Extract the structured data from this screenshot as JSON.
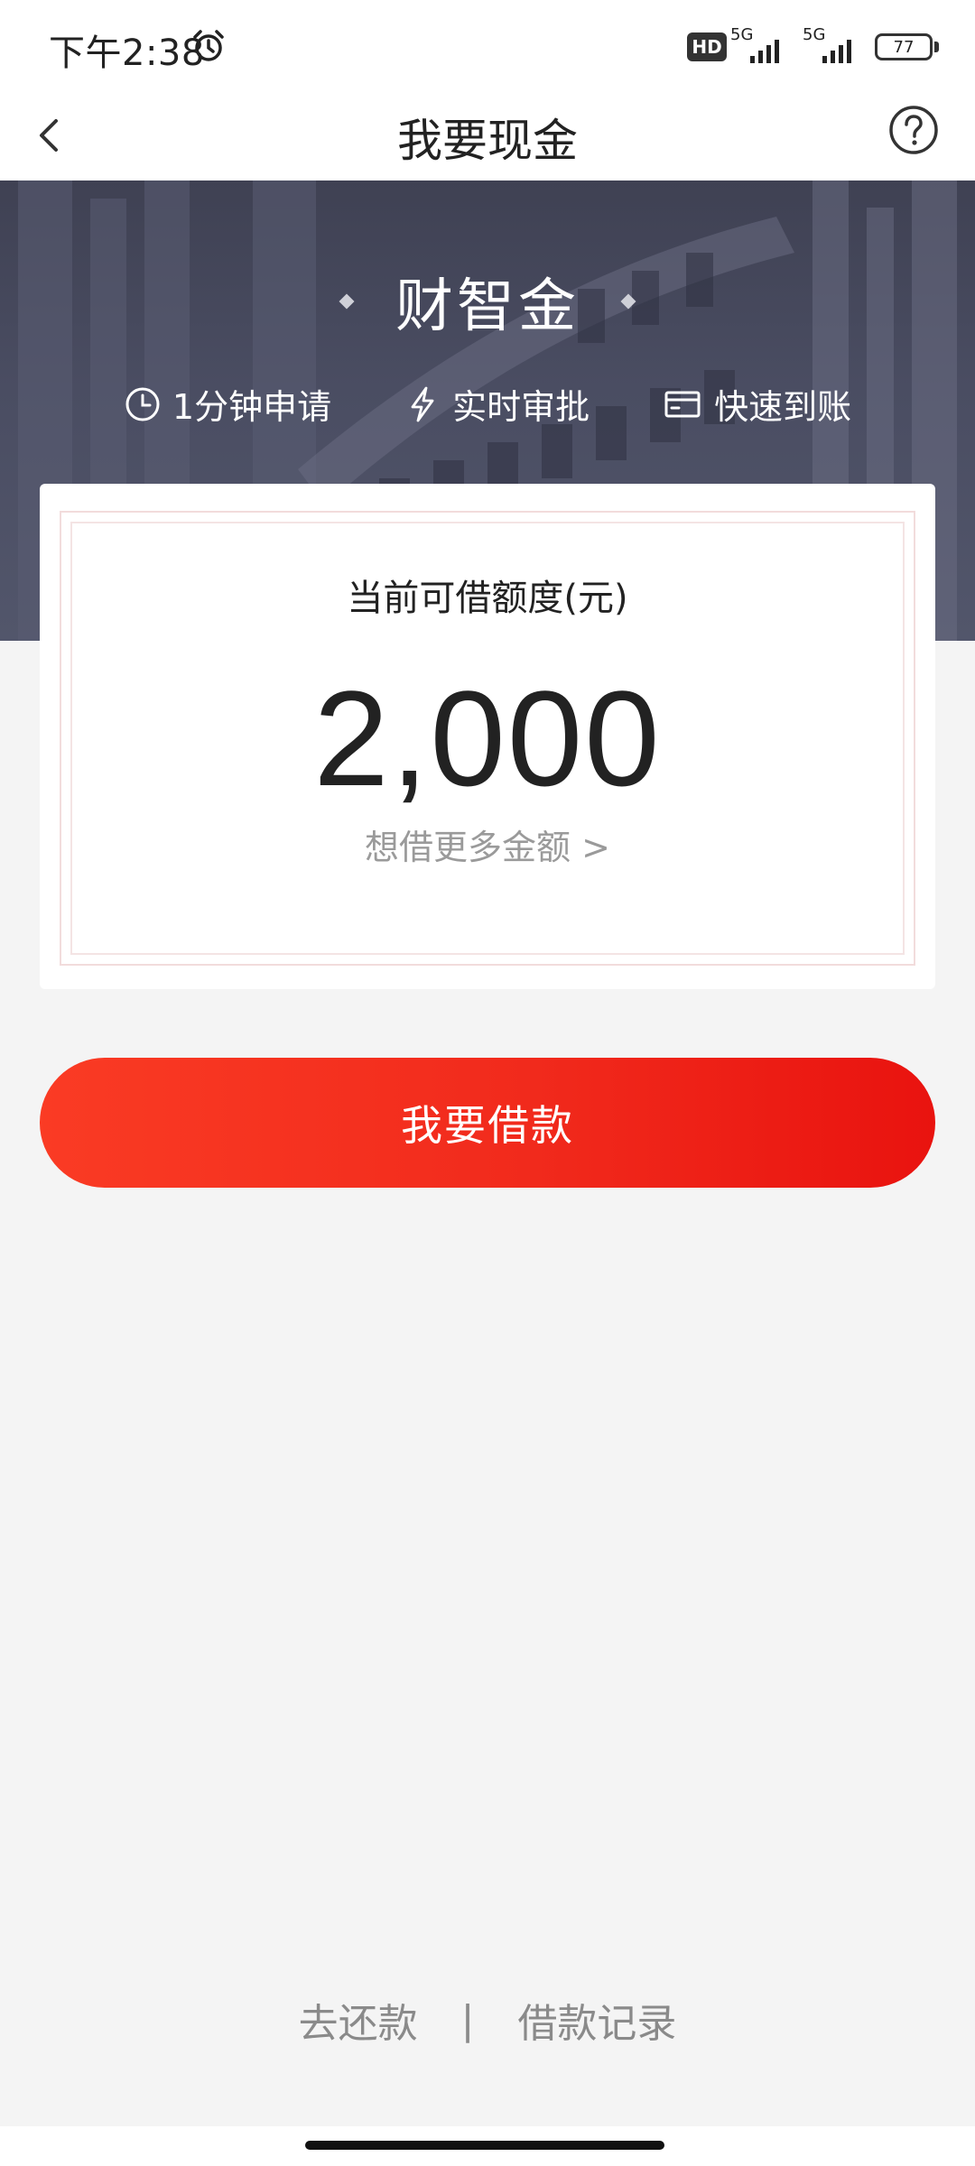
{
  "status_bar": {
    "time": "下午2:38",
    "hd_label": "HD",
    "network_1": "5G",
    "network_2": "5G",
    "battery": "77"
  },
  "nav": {
    "title": "我要现金",
    "back_icon": "chevron-left-icon",
    "help_icon": "question-circle-icon"
  },
  "hero": {
    "title": "财智金",
    "features": [
      {
        "icon": "clock-icon",
        "label": "1分钟申请"
      },
      {
        "icon": "lightning-icon",
        "label": "实时审批"
      },
      {
        "icon": "card-icon",
        "label": "快速到账"
      }
    ]
  },
  "credit": {
    "label": "当前可借额度(元)",
    "amount": "2,000",
    "more_link": "想借更多金额 >"
  },
  "borrow_button": "我要借款",
  "footer": {
    "repay": "去还款",
    "divider": "|",
    "records": "借款记录"
  },
  "colors": {
    "accent_start": "#fa3b24",
    "accent_end": "#e9130f",
    "hero_bg": "#45485c",
    "page_bg": "#f4f4f4"
  }
}
